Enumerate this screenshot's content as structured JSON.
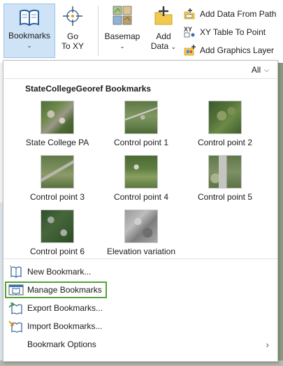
{
  "ribbon": {
    "bookmarks_label": "Bookmarks",
    "goto_label_line1": "Go",
    "goto_label_line2": "To XY",
    "basemap_label": "Basemap",
    "adddata_label_line1": "Add",
    "adddata_label_line2": "Data",
    "add_data_from_path": "Add Data From Path",
    "xy_table_to_point": "XY Table To Point",
    "add_graphics_layer": "Add Graphics Layer",
    "xy_icon_text": "XY"
  },
  "dropdown": {
    "filter_value": "All",
    "group_title": "StateCollegeGeoref Bookmarks",
    "bookmarks": [
      {
        "label": "State College PA",
        "thumb": "aerial-town"
      },
      {
        "label": "Control point 1",
        "thumb": "aerial-field"
      },
      {
        "label": "Control point 2",
        "thumb": "aerial-forest"
      },
      {
        "label": "Control point 3",
        "thumb": "aerial-road"
      },
      {
        "label": "Control point 4",
        "thumb": "aerial-farm"
      },
      {
        "label": "Control point 5",
        "thumb": "aerial-parking"
      },
      {
        "label": "Control point 6",
        "thumb": "aerial-suburb"
      },
      {
        "label": "Elevation variation",
        "thumb": "grayscale-hillshade"
      }
    ],
    "menu": [
      {
        "label": "New Bookmark...",
        "icon": "new-bookmark-icon"
      },
      {
        "label": "Manage Bookmarks",
        "icon": "manage-bookmarks-icon",
        "highlighted": true
      },
      {
        "label": "Export Bookmarks...",
        "icon": "export-bookmarks-icon"
      },
      {
        "label": "Import Bookmarks...",
        "icon": "import-bookmarks-icon"
      },
      {
        "label": "Bookmark Options",
        "icon": "",
        "submenu": true
      }
    ]
  },
  "colors": {
    "selected_button_bg": "#cfe3f7",
    "highlight_outline": "#53a337"
  }
}
